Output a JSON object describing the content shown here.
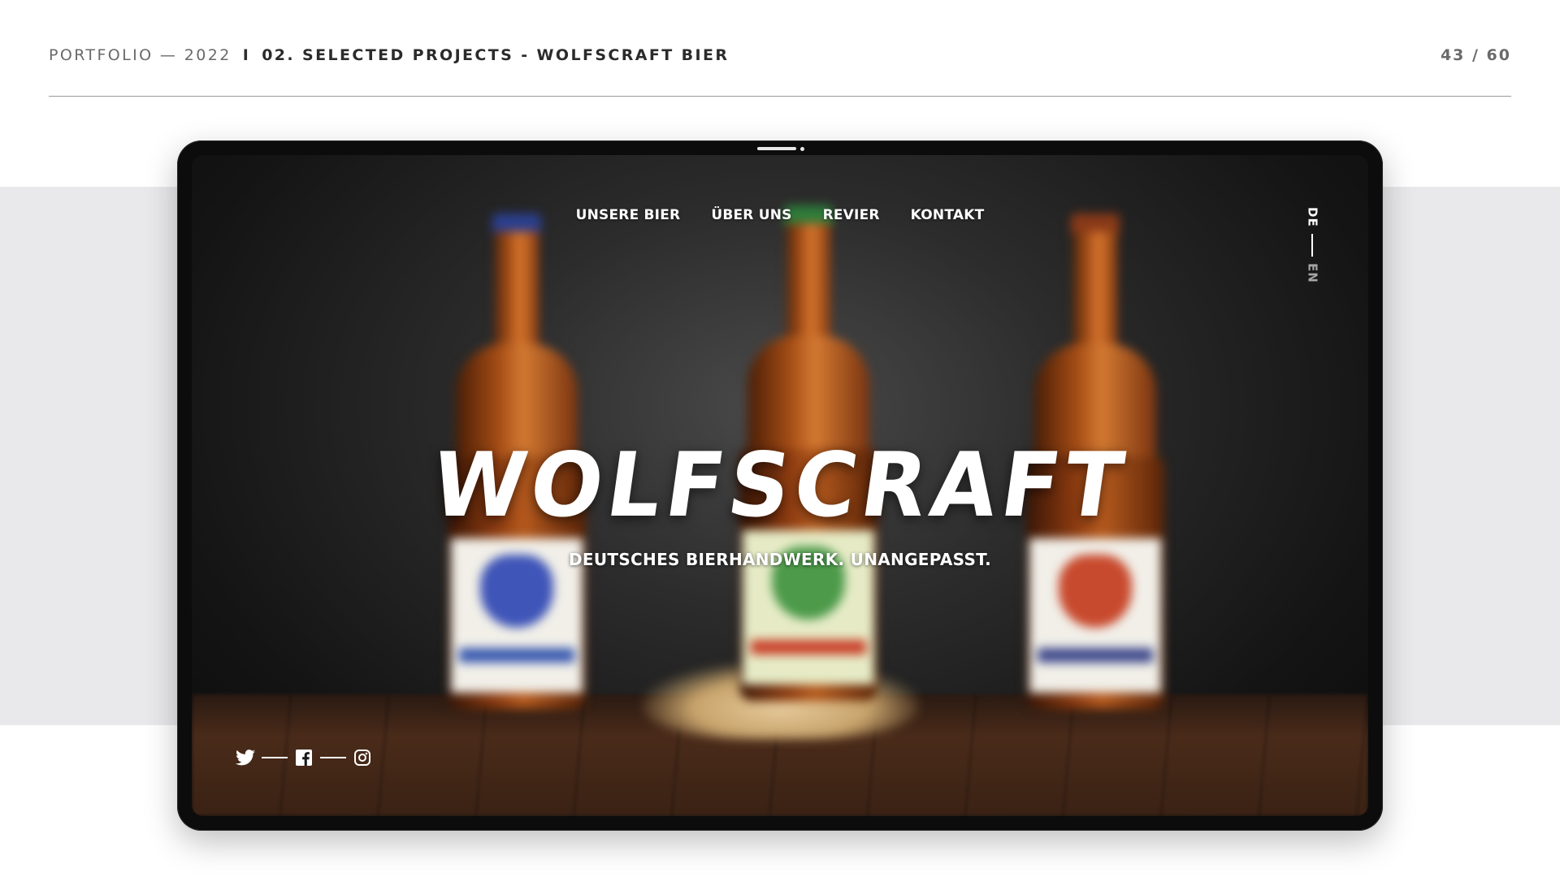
{
  "slide": {
    "portfolio_label": "PORTFOLIO — 2022",
    "separator": "I",
    "project_label": "02. SELECTED PROJECTS - WOLFSCRAFT BIER",
    "page_counter": "43 / 60"
  },
  "website": {
    "nav": [
      "UNSERE BIER",
      "ÜBER UNS",
      "REVIER",
      "KONTAKT"
    ],
    "languages": {
      "active": "DE",
      "inactive": "EN"
    },
    "hero": {
      "logo": "WOLFSCRAFT",
      "tagline": "DEUTSCHES BIERHANDWERK. UNANGEPASST."
    },
    "social_icons": [
      "twitter-icon",
      "facebook-icon",
      "instagram-icon"
    ]
  },
  "colors": {
    "band": "#e9e9eb",
    "device": "#0c0c0c",
    "text_dark": "#2b2b2b",
    "text_muted": "#6a6a6a",
    "white": "#ffffff"
  }
}
